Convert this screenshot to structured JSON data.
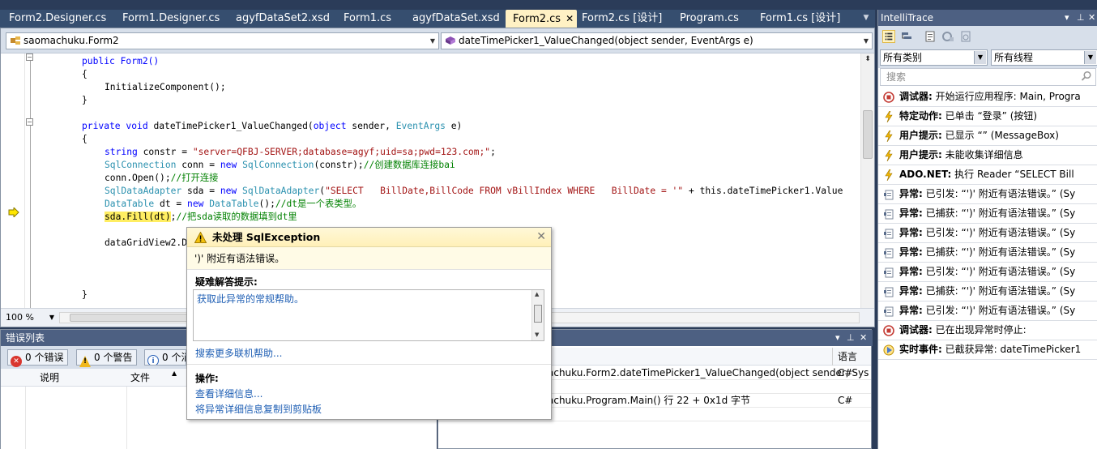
{
  "tabs": [
    {
      "label": "Form2.Designer.cs",
      "active": false
    },
    {
      "label": "Form1.Designer.cs",
      "active": false
    },
    {
      "label": "agyfDataSet2.xsd",
      "active": false
    },
    {
      "label": "Form1.cs",
      "active": false
    },
    {
      "label": "agyfDataSet.xsd",
      "active": false
    },
    {
      "label": "Form2.cs",
      "active": true
    },
    {
      "label": "Form2.cs [设计]",
      "active": false
    },
    {
      "label": "Program.cs",
      "active": false
    },
    {
      "label": "Form1.cs [设计]",
      "active": false
    }
  ],
  "tab_close_glyph": "✕",
  "nav": {
    "class_combo": "saomachuku.Form2",
    "member_combo": "dateTimePicker1_ValueChanged(object sender, EventArgs e)"
  },
  "code": {
    "l1": "public Form2()",
    "l2": "{",
    "l3": "InitializeComponent();",
    "l4": "}",
    "l6_kw1": "private",
    "l6_kw2": "void",
    "l6_mid": " dateTimePicker1_ValueChanged(",
    "l6_kw3": "object",
    "l6_mid2": " sender, ",
    "l6_ty": "EventArgs",
    "l6_end": " e)",
    "l7": "{",
    "l8_kw": "string",
    "l8_mid": " constr = ",
    "l8_str": "\"server=QFBJ-SERVER;database=agyf;uid=sa;pwd=123.com;\"",
    "l8_end": ";",
    "l9_ty": "SqlConnection",
    "l9_mid": " conn = ",
    "l9_kw": "new",
    "l9_sp": " ",
    "l9_ty2": "SqlConnection",
    "l9_end": "(constr);",
    "l9_cm": "//创建数据库连接bai",
    "l10": "conn.Open();",
    "l10_cm": "//打开连接",
    "l11_ty": "SqlDataAdapter",
    "l11_mid": " sda = ",
    "l11_kw": "new",
    "l11_sp": " ",
    "l11_ty2": "SqlDataAdapter",
    "l11_open": "(",
    "l11_str": "\"SELECT   BillDate,BillCode FROM vBillIndex WHERE   BillDate = '\"",
    "l11_end": " + this.dateTimePicker1.Value",
    "l12_ty": "DataTable",
    "l12_mid": " dt = ",
    "l12_kw": "new",
    "l12_sp": " ",
    "l12_ty2": "DataTable",
    "l12_end": "();",
    "l12_cm": "//dt是一个表类型。",
    "l13_hl": "sda.Fill(dt)",
    "l13_end": ";",
    "l13_cm": "//把sda读取的数据填到dt里",
    "l15": "dataGridView2.D",
    "l19": "}"
  },
  "zoom": "100 %",
  "error_list": {
    "title": "错误列表",
    "errors": "0 个错误",
    "warnings": "0 个警告",
    "messages": "0 个消",
    "col_description": "说明",
    "col_file": "文件"
  },
  "call_stack": {
    "col_lang": "语言",
    "rows": [
      {
        "name": "achuku.Form2.dateTimePicker1_ValueChanged(object sender, Sys",
        "lang": "C#"
      },
      {
        "name": "achuku.Program.Main() 行 22 + 0x1d 字节",
        "lang": "C#"
      }
    ]
  },
  "exception": {
    "title": "未处理 SqlException",
    "message": "')' 附近有语法错误。",
    "tips_heading": "疑难解答提示:",
    "tip_link": "获取此异常的常规帮助。",
    "search_link": "搜索更多联机帮助...",
    "actions_heading": "操作:",
    "action_details": "查看详细信息...",
    "action_copy": "将异常详细信息复制到剪贴板"
  },
  "intellitrace": {
    "title": "IntelliTrace",
    "category_filter": "所有类别",
    "thread_filter": "所有线程",
    "search_placeholder": "搜索",
    "events": [
      {
        "icon": "debugger",
        "kind": "调试器:",
        "text": " 开始运行应用程序: Main, Progra"
      },
      {
        "icon": "bolt",
        "kind": "特定动作:",
        "text": " 已单击 “登录” (按钮)"
      },
      {
        "icon": "bolt",
        "kind": "用户提示:",
        "text": " 已显示 “” (MessageBox)"
      },
      {
        "icon": "bolt",
        "kind": "用户提示:",
        "text": " 未能收集详细信息"
      },
      {
        "icon": "bolt",
        "kind": "ADO.NET:",
        "text": " 执行 Reader “SELECT   Bill"
      },
      {
        "icon": "exception",
        "kind": "异常:",
        "text": " 已引发: “')' 附近有语法错误。” (Sy"
      },
      {
        "icon": "exception",
        "kind": "异常:",
        "text": " 已捕获: “')' 附近有语法错误。” (Sy"
      },
      {
        "icon": "exception",
        "kind": "异常:",
        "text": " 已引发: “')' 附近有语法错误。” (Sy"
      },
      {
        "icon": "exception",
        "kind": "异常:",
        "text": " 已捕获: “')' 附近有语法错误。” (Sy"
      },
      {
        "icon": "exception",
        "kind": "异常:",
        "text": " 已引发: “')' 附近有语法错误。” (Sy"
      },
      {
        "icon": "exception",
        "kind": "异常:",
        "text": " 已捕获: “')' 附近有语法错误。” (Sy"
      },
      {
        "icon": "exception",
        "kind": "异常:",
        "text": " 已引发: “')' 附近有语法错误。” (Sy"
      },
      {
        "icon": "debugger",
        "kind": "调试器:",
        "text": " 已在出现异常时停止:"
      },
      {
        "icon": "live",
        "kind": "实时事件:",
        "text": " 已截获异常: dateTimePicker1"
      }
    ]
  },
  "colors": {
    "chrome": "#2b3c59",
    "panel_title": "#4d6082",
    "active_tab": "#fff1c4",
    "keyword": "#0000ff",
    "type": "#2b91af",
    "string": "#a31515",
    "comment": "#008000",
    "link": "#1f5fb4"
  }
}
